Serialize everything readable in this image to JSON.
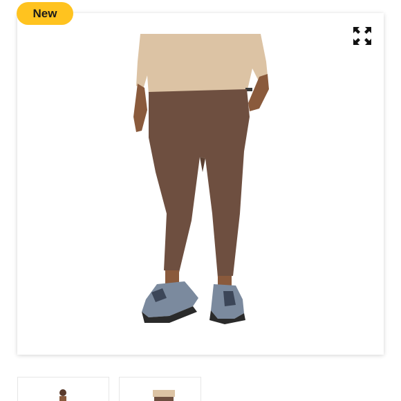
{
  "badge": {
    "label": "New",
    "color": "#FFC31F"
  },
  "gallery": {
    "expand_icon": "expand-arrows-icon",
    "main_image": "product-photo-brown-leggings",
    "colors": {
      "leggings": "#6E4F40",
      "top": "#DCC3A4",
      "shoe": "#7B8A9E",
      "skin": "#8A5A3C"
    },
    "thumbnails": [
      {
        "name": "thumbnail-full-body"
      },
      {
        "name": "thumbnail-close-up"
      }
    ]
  }
}
